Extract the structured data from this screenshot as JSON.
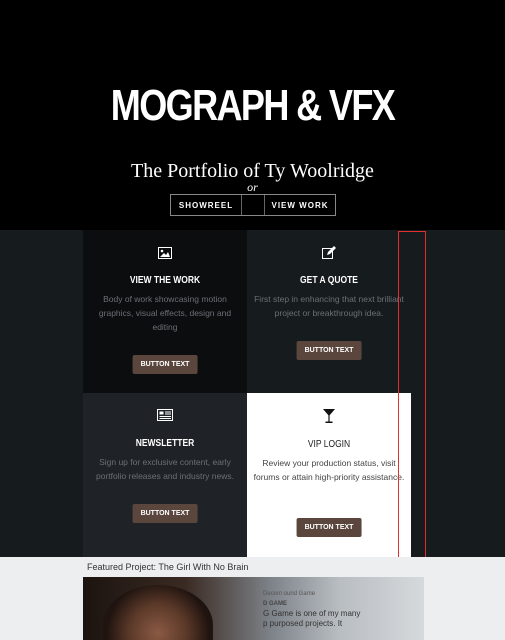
{
  "hero": {
    "title": "MOGRAPH & VFX",
    "subtitle": "The Portfolio of Ty Woolridge",
    "or": "or",
    "showreel": "SHOWREEL",
    "view_work": "VIEW WORK"
  },
  "cards": [
    {
      "icon": "image-icon",
      "title": "VIEW THE WORK",
      "text": "Body of work showcasing motion graphics, visual effects, design and editing",
      "button": "BUTTON TEXT"
    },
    {
      "icon": "edit-icon",
      "title": "GET A QUOTE",
      "text": "First step in enhancing that next brilliant project or breakthrough idea.",
      "button": "BUTTON TEXT"
    },
    {
      "icon": "newspaper-icon",
      "title": "NEWSLETTER",
      "text": "Sign up for exclusive content, early portfolio releases and industry news.",
      "button": "BUTTON TEXT"
    },
    {
      "icon": "cocktail-icon",
      "title": "VIP LOGIN",
      "text": "Review your production status, visit forums or attain high-priority assistance.",
      "button": "BUTTON TEXT"
    }
  ],
  "featured": {
    "title": "Featured Project: The Girl With No Brain",
    "meta": "Decem      ound Game",
    "heading": "D GAME",
    "line1": "G      Game is one of my many",
    "line2": "p      purposed projects. It"
  }
}
